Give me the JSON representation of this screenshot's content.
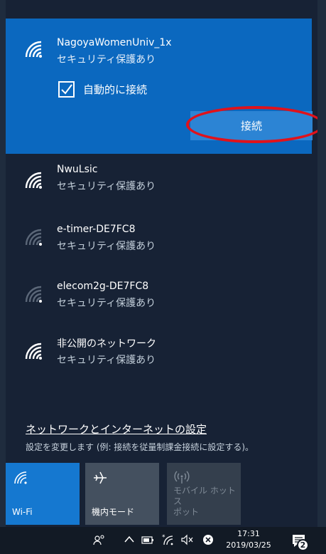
{
  "networks": [
    {
      "name": "NagoyaWomenUniv_1x",
      "security": "セキュリティ保護あり",
      "signal_bars": 4
    },
    {
      "name": "NwuLsic",
      "security": "セキュリティ保護あり",
      "signal_bars": 4
    },
    {
      "name": "e-timer-DE7FC8",
      "security": "セキュリティ保護あり",
      "signal_bars": 1
    },
    {
      "name": "elecom2g-DE7FC8",
      "security": "セキュリティ保護あり",
      "signal_bars": 1
    },
    {
      "name": "非公開のネットワーク",
      "security": "セキュリティ保護あり",
      "signal_bars": 4
    }
  ],
  "selected": {
    "auto_connect_label": "自動的に接続",
    "auto_connect_checked": true,
    "connect_label": "接続"
  },
  "settings": {
    "link": "ネットワークとインターネットの設定",
    "description": "設定を変更します (例: 接続を従量制課金接続に設定する)。"
  },
  "quick_actions": [
    {
      "label": "Wi-Fi",
      "icon": "wifi-icon",
      "state": "on"
    },
    {
      "label": "機内モード",
      "icon": "airplane-icon",
      "state": "off"
    },
    {
      "label": "モバイル ホットスポット",
      "label_lines": [
        "モバイル ホットス",
        "ポット"
      ],
      "icon": "hotspot-icon",
      "state": "disabled"
    }
  ],
  "taskbar": {
    "time": "17:31",
    "date": "2019/03/25",
    "notification_count": "2"
  },
  "colors": {
    "selected_bg": "#0b68bf",
    "connect_button": "#2c84d4",
    "highlight_ring": "#e0121b",
    "panel_bg": "#172235",
    "wifi_tile_on": "#1578d0"
  }
}
